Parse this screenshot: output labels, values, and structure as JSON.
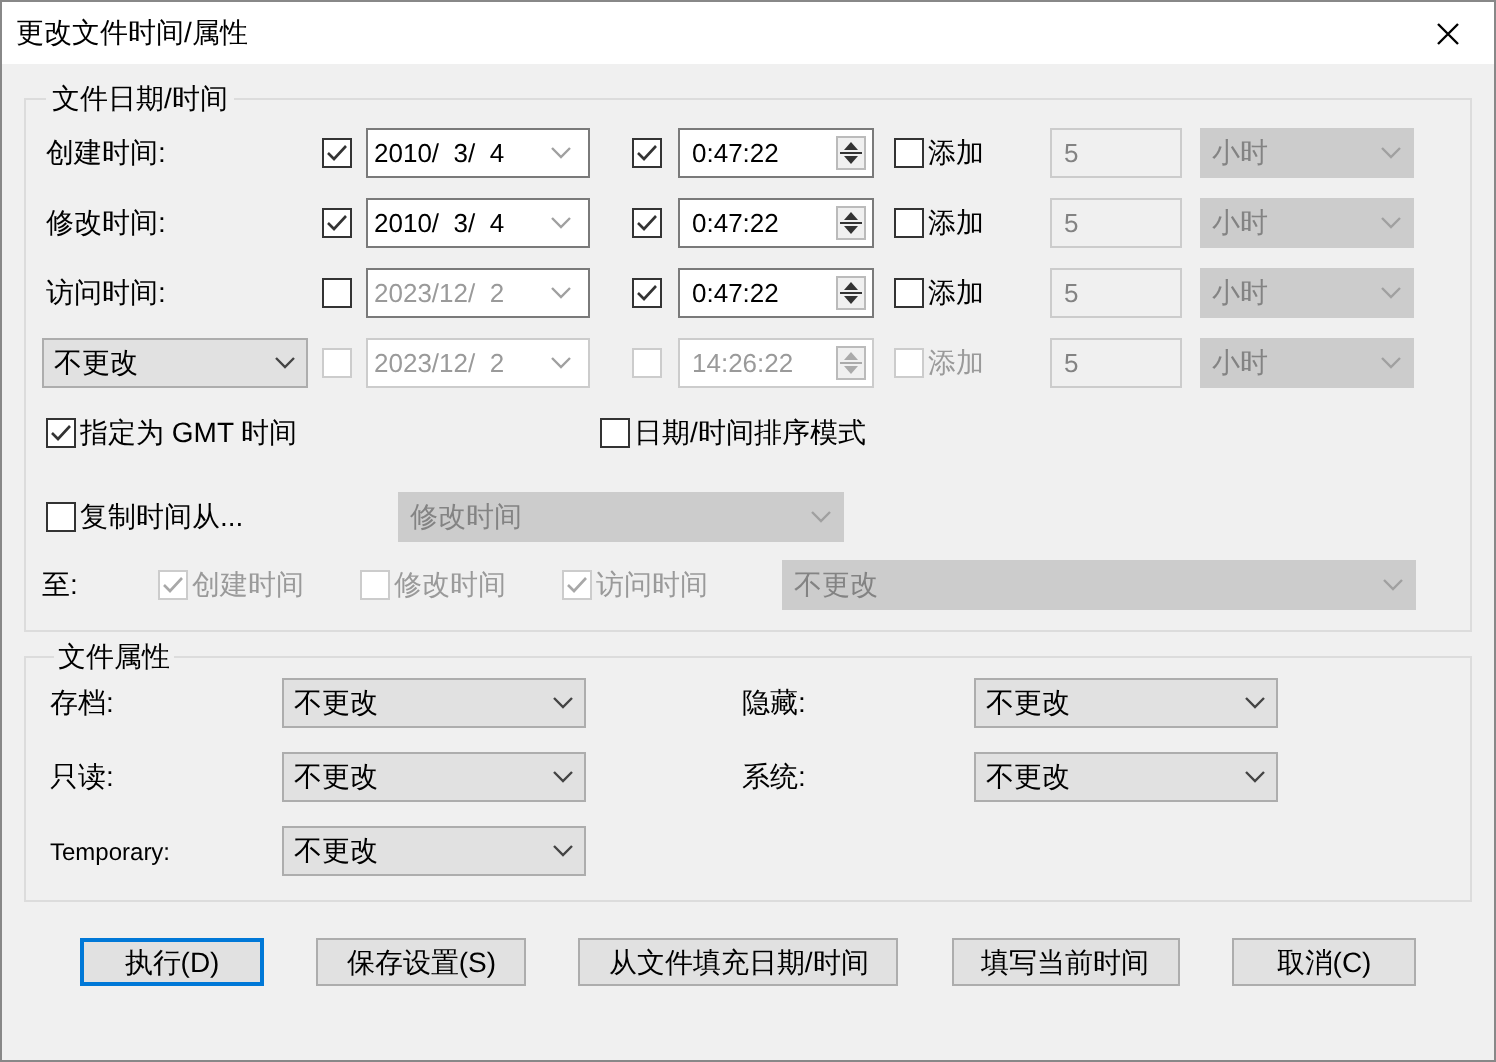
{
  "window": {
    "title": "更改文件时间/属性"
  },
  "date_time_group": {
    "title": "文件日期/时间",
    "rows": [
      {
        "kind": "label",
        "label": "创建时间:",
        "disabled": false,
        "date_checked": true,
        "date": "2010/  3/  4",
        "time_checked": true,
        "time": "0:47:22",
        "add_checked": false,
        "add_label": "添加",
        "amount": "5",
        "unit": "小时"
      },
      {
        "kind": "label",
        "label": "修改时间:",
        "disabled": false,
        "date_checked": true,
        "date": "2010/  3/  4",
        "time_checked": true,
        "time": "0:47:22",
        "add_checked": false,
        "add_label": "添加",
        "amount": "5",
        "unit": "小时"
      },
      {
        "kind": "label",
        "label": "访问时间:",
        "disabled": false,
        "date_checked": false,
        "date": "2023/12/  2",
        "time_checked": true,
        "time": "0:47:22",
        "add_checked": false,
        "add_label": "添加",
        "amount": "5",
        "unit": "小时"
      },
      {
        "kind": "select",
        "label": "不更改",
        "disabled": true,
        "date_checked": false,
        "date": "2023/12/  2",
        "time_checked": false,
        "time": "14:26:22",
        "add_checked": false,
        "add_label": "添加",
        "amount": "5",
        "unit": "小时"
      }
    ],
    "gmt": {
      "label": "指定为 GMT 时间",
      "checked": true
    },
    "sort_mode": {
      "label": "日期/时间排序模式",
      "checked": false
    },
    "copy_from": {
      "label": "复制时间从...",
      "checked": false,
      "value": "修改时间"
    },
    "to": {
      "label": "至:",
      "targets": [
        {
          "label": "创建时间",
          "checked": true
        },
        {
          "label": "修改时间",
          "checked": false
        },
        {
          "label": "访问时间",
          "checked": true
        }
      ],
      "value": "不更改"
    }
  },
  "attributes_group": {
    "title": "文件属性",
    "items": [
      {
        "label": "存档:",
        "value": "不更改"
      },
      {
        "label": "隐藏:",
        "value": "不更改"
      },
      {
        "label": "只读:",
        "value": "不更改"
      },
      {
        "label": "系统:",
        "value": "不更改"
      },
      {
        "label": "Temporary:",
        "value": "不更改"
      }
    ]
  },
  "buttons": [
    {
      "label": "执行(D)",
      "default": true
    },
    {
      "label": "保存设置(S)",
      "default": false
    },
    {
      "label": "从文件填充日期/时间",
      "default": false
    },
    {
      "label": "填写当前时间",
      "default": false
    },
    {
      "label": "取消(C)",
      "default": false
    }
  ]
}
